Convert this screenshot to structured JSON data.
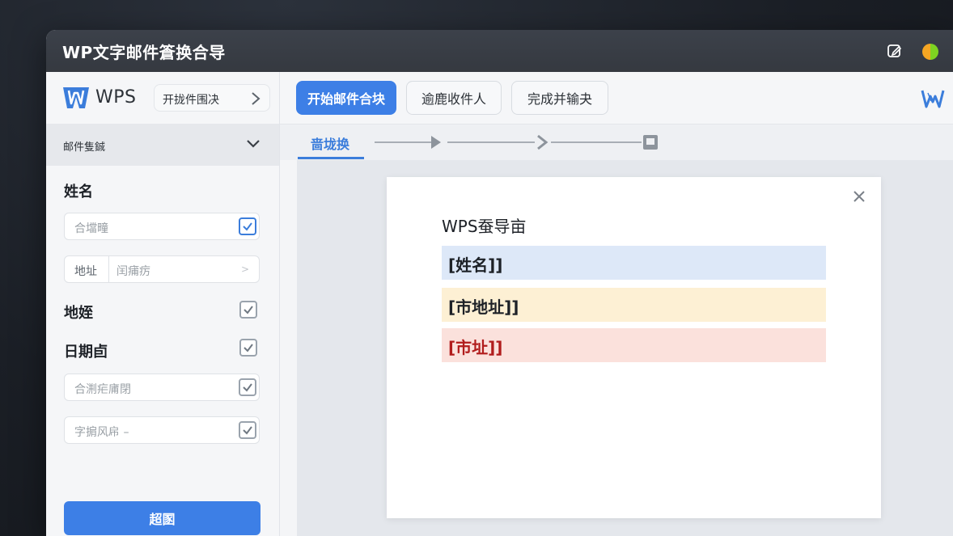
{
  "window": {
    "title": "WP文字邮件篬换合导"
  },
  "sidebar": {
    "brand_name": "WPS",
    "brand_button": "开拢件围决",
    "section_title": "邮件隻鋮",
    "fields": [
      {
        "label": "姓名"
      },
      {
        "placeholder": "合壋疃",
        "checked": true
      },
      {
        "prefix": "地址",
        "placeholder": "闰痡疠",
        "arrow": ">"
      },
      {
        "label": "地姪",
        "checked": true
      },
      {
        "label": "日期卣",
        "checked": true
      },
      {
        "placeholder": "合渆疟庯閉",
        "checked": true
      },
      {
        "placeholder": "字掮风帍 –",
        "checked": true
      }
    ],
    "primary_button": "超圂"
  },
  "toolbar": {
    "buttons": [
      "开始邮件合块",
      "逾鹿收件人",
      "完成并输夬"
    ]
  },
  "steps": {
    "active_tab": "啬垅换"
  },
  "document": {
    "title": "WPS蚕导亩",
    "merge_fields": [
      "[姓名]]",
      "[市地址]]",
      "[市址]]"
    ]
  },
  "colors": {
    "accent": "#3d7fe6",
    "field_blue": "#dde8f8",
    "field_yellow": "#fdf0d4",
    "field_red": "#fbe1dc",
    "field_red_text": "#b11c1c"
  },
  "icons": {
    "titlebar": [
      "edit-window-icon",
      "status-dot-icon"
    ],
    "brand": "wps-logo-icon",
    "close": "close-icon",
    "check": "checkmark-icon"
  }
}
